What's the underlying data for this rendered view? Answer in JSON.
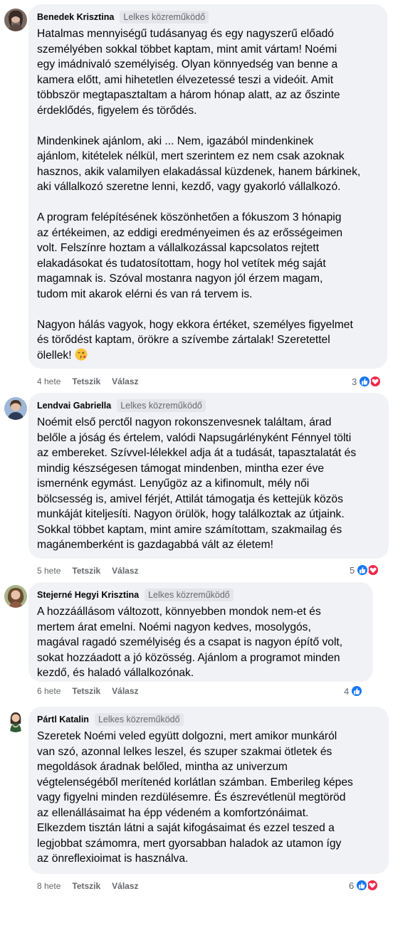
{
  "comments": [
    {
      "author": "Benedek Krisztina",
      "badge": "Lelkes közreműködő",
      "paragraphs": [
        [
          "Hatalmas mennyiségű tudásanyag és egy nagyszerű előadó",
          "személyében sokkal többet kaptam, mint amit vártam! Noémi",
          "egy imádnivaló személyiség. Olyan könnyedség van benne a",
          "kamera előtt, ami hihetetlen élvezetessé teszi a videóit. Amit",
          "többször megtapasztaltam a három hónap alatt, az az őszinte",
          "érdeklődés, figyelem és törődés."
        ],
        [
          "Mindenkinek ajánlom, aki ... Nem, igazából mindenkinek",
          "ajánlom, kitételek nélkül, mert szerintem ez nem csak azoknak",
          "hasznos, akik valamilyen elakadással küzdenek, hanem bárkinek,",
          "aki vállalkozó szeretne lenni, kezdő, vagy gyakorló vállalkozó."
        ],
        [
          "A program felépítésének köszönhetően a fókuszom 3 hónapig",
          "az értékeimen, az eddigi eredményeimen és az erősségeimen",
          "volt. Felszínre hoztam a vállalkozással kapcsolatos rejtett",
          "elakadásokat és tudatosítottam, hogy hol vetítek még saját",
          "magamnak is. Szóval mostanra nagyon jól érzem magam,",
          "tudom mit akarok elérni és van rá tervem is."
        ],
        [
          "Nagyon hálás vagyok, hogy ekkora értéket, személyes figyelmet",
          "és törődést kaptam, örökre a szívembe zártalak! Szeretettel",
          "ölellek!"
        ]
      ],
      "time": "4 hete",
      "like_label": "Tetszik",
      "reply_label": "Válasz",
      "reaction_count": "3",
      "reactions": [
        "like-icon",
        "love-icon"
      ]
    },
    {
      "author": "Lendvai Gabriella",
      "badge": "Lelkes közreműködő",
      "paragraphs": [
        [
          "Noémit első perctől nagyon rokonszenvesnek találtam, árad",
          "belőle a jóság és értelem, valódi Napsugárlényként Fénnyel tölti",
          "az embereket.  Szívvel-lélekkel adja át a tudását, tapasztalatát és",
          "mindig készségesen támogat mindenben, mintha ezer éve",
          "ismernénk egymást. Lenyűgöz az a kifinomult, mély női",
          "bölcsesség is, amivel férjét, Attilát támogatja és kettejük közös",
          "munkáját kiteljesíti. Nagyon örülök, hogy találkoztak az útjaink.",
          "Sokkal többet kaptam, mint amire számítottam, szakmailag és",
          "magánemberként is gazdagabbá vált az életem!"
        ]
      ],
      "time": "5 hete",
      "like_label": "Tetszik",
      "reply_label": "Válasz",
      "reaction_count": "5",
      "reactions": [
        "like-icon",
        "love-icon"
      ]
    },
    {
      "author": "Stejerné Hegyi Krisztina",
      "badge": "Lelkes közreműködő",
      "paragraphs": [
        [
          "A hozzáállásom változott, könnyebben mondok nem-et és",
          "mertem árat emelni. Noémi nagyon kedves, mosolygós,",
          "magával ragadó személyiség és a csapat is nagyon építő volt,",
          "sokat hozzáadott a jó közösség. Ajánlom a programot minden",
          "kezdő, és haladó vállalkozónak."
        ]
      ],
      "time": "6 hete",
      "like_label": "Tetszik",
      "reply_label": "Válasz",
      "reaction_count": "4",
      "reactions": [
        "like-icon"
      ]
    },
    {
      "author": "Pártl Katalin",
      "badge": "Lelkes közreműködő",
      "paragraphs": [
        [
          "Szeretek Noémi veled együtt dolgozni, mert amikor munkáról",
          "van szó, azonnal lelkes leszel, és szuper szakmai ötletek és",
          "megoldások áradnak belőled, mintha az univerzum",
          "végtelenségéből merítenéd korlátlan számban. Emberileg képes",
          "vagy figyelni minden rezdülésemre. És észrevétlenül megtöröd",
          "az ellenállásaimat ha épp védeném a komfortzónáimat.",
          "Elkezdem tisztán látni a saját kifogásaimat és ezzel teszed a",
          "legjobbat számomra, mert gyorsabban haladok az utamon így",
          "az önreflexioimat is használva."
        ]
      ],
      "time": "8 hete",
      "like_label": "Tetszik",
      "reply_label": "Válasz",
      "reaction_count": "6",
      "reactions": [
        "like-icon",
        "love-icon"
      ]
    }
  ],
  "colors": {
    "bubble": "#f0f2f5",
    "like": "#1877f2",
    "love": "#f0284a",
    "meta": "#65676b"
  }
}
